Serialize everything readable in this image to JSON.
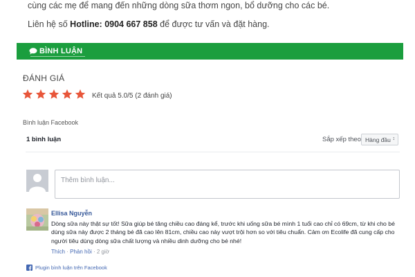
{
  "article": {
    "intro_tail": "cùng các mẹ để mang đến những dòng sữa thơm ngon, bổ dưỡng cho các bé.",
    "contact_prefix": "Liên hệ số ",
    "hotline_label": "Hotline:",
    "hotline_number": "0904 667 858",
    "contact_suffix": " để được tư vấn và đặt hàng."
  },
  "comments_section": {
    "title": "BÌNH LUẬN",
    "icon": "comment-icon",
    "accent_color": "#1b9e3e"
  },
  "rating": {
    "title": "ĐÁNH GIÁ",
    "stars": 5,
    "max_stars": 5,
    "star_color": "#e8563a",
    "summary": "Kết quả 5.0/5 (2 đánh giá)"
  },
  "facebook_comments": {
    "label": "Bình luận Facebook",
    "count_text": "1 bình luận",
    "sort_label": "Sắp xếp theo",
    "sort_selected": "Hàng đầu",
    "compose_placeholder": "Thêm bình luận...",
    "comments": [
      {
        "author": "Ellisa Nguyễn",
        "text": "Dòng sữa này thật sự tốt! Sữa giúp bé tăng chiều cao đáng kể, trước khi uống sữa bé mình 1 tuổi cao chỉ có 69cm, từ khi cho bé dùng sữa này được 2 tháng bé đã cao lên 81cm, chiều cao này vượt trội hơn so với tiêu chuẩn. Cảm ơn Ecolife đã cung cấp cho người tiêu dùng dòng sữa chất lượng và nhiều dinh dưỡng cho bé nhé!",
        "like": "Thích",
        "reply": "Phản hồi",
        "time": "2 giờ"
      }
    ],
    "plugin_text": "Plugin bình luận trên Facebook",
    "link_color": "#4267b2"
  }
}
